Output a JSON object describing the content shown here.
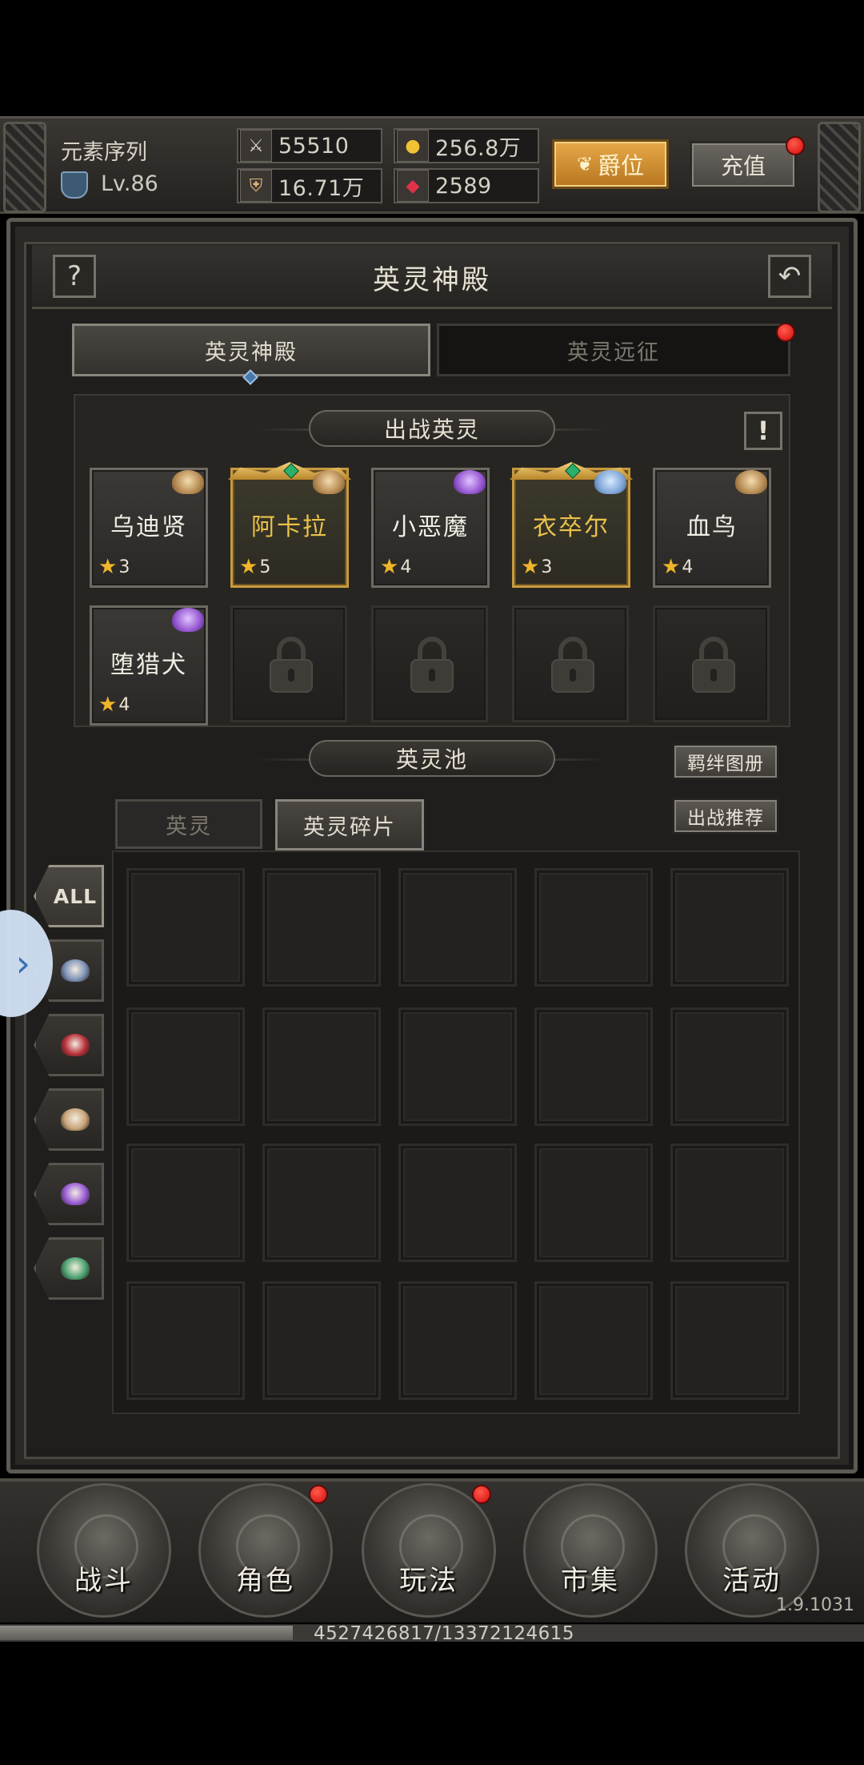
{
  "header": {
    "player_name": "元素序列",
    "level": "Lv.86",
    "power": "55510",
    "defense": "16.71万",
    "gold": "256.8万",
    "gems": "2589",
    "rank_button": "爵位",
    "recharge_button": "充值"
  },
  "panel": {
    "help_label": "?",
    "title": "英灵神殿",
    "tabs": [
      {
        "label": "英灵神殿",
        "active": true
      },
      {
        "label": "英灵远征",
        "active": false
      }
    ],
    "deploy_banner": "出战英灵",
    "info_label": "!",
    "deployed": [
      {
        "name": "乌迪贤",
        "stars": "3",
        "rarity": "normal",
        "faction": "gold"
      },
      {
        "name": "阿卡拉",
        "stars": "5",
        "rarity": "legend",
        "faction": "gold"
      },
      {
        "name": "小恶魔",
        "stars": "4",
        "rarity": "normal",
        "faction": "purple"
      },
      {
        "name": "衣卒尔",
        "stars": "3",
        "rarity": "legend",
        "faction": "blue"
      },
      {
        "name": "血鸟",
        "stars": "4",
        "rarity": "normal",
        "faction": "gold"
      },
      {
        "name": "堕猎犬",
        "stars": "4",
        "rarity": "normal",
        "faction": "purple"
      }
    ],
    "locked_slots": 4,
    "pool_banner": "英灵池",
    "bond_button": "羁绊图册",
    "recommend_button": "出战推荐",
    "pool_tabs": [
      {
        "label": "英灵",
        "active": false
      },
      {
        "label": "英灵碎片",
        "active": true
      }
    ],
    "filters": [
      {
        "label": "ALL",
        "icon": "all",
        "active": true
      },
      {
        "label": "",
        "icon": "winged-helm-icon",
        "color": "#7f93b8"
      },
      {
        "label": "",
        "icon": "demon-bat-icon",
        "color": "#b8303a"
      },
      {
        "label": "",
        "icon": "skull-icon",
        "color": "#c9a57a"
      },
      {
        "label": "",
        "icon": "purple-crest-icon",
        "color": "#9b5ed6"
      },
      {
        "label": "",
        "icon": "green-skull-icon",
        "color": "#4fa372"
      }
    ],
    "grid_rows": 4,
    "grid_cols": 5
  },
  "nav": [
    {
      "label": "战斗",
      "icon": "crossed-swords-icon",
      "badge": false
    },
    {
      "label": "角色",
      "icon": "knight-helmet-icon",
      "badge": true
    },
    {
      "label": "玩法",
      "icon": "scroll-map-icon",
      "badge": true
    },
    {
      "label": "市集",
      "icon": "scales-icon",
      "badge": false
    },
    {
      "label": "活动",
      "icon": "rose-icon",
      "badge": false
    }
  ],
  "version": "1.9.1031",
  "experience": {
    "text": "4527426817/13372124615",
    "fraction": 0.3386
  },
  "colors": {
    "gold_accent": "#c69a3e",
    "legend_name": "#e9c24a",
    "alert_red": "#d20c0c"
  }
}
